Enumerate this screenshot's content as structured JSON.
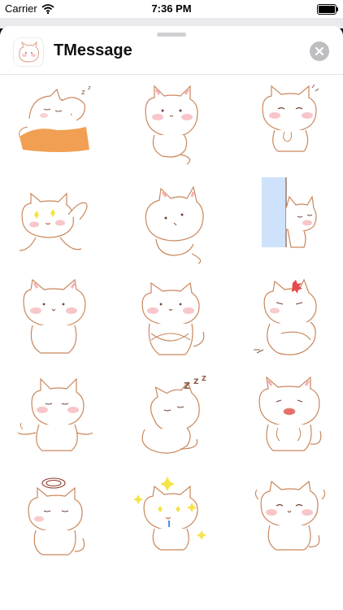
{
  "status_bar": {
    "carrier": "Carrier",
    "time": "7:36 PM"
  },
  "app": {
    "title": "TMessage"
  },
  "stickers": [
    {
      "name": "sleeping"
    },
    {
      "name": "blush-look"
    },
    {
      "name": "hands-together"
    },
    {
      "name": "sparkle-wave"
    },
    {
      "name": "peek-up"
    },
    {
      "name": "door-peek"
    },
    {
      "name": "blank-stare"
    },
    {
      "name": "arms-crossed"
    },
    {
      "name": "angry-crossed"
    },
    {
      "name": "meditate"
    },
    {
      "name": "sleepy-zzz"
    },
    {
      "name": "shocked"
    },
    {
      "name": "dizzy"
    },
    {
      "name": "sparkle-drool"
    },
    {
      "name": "happy"
    }
  ],
  "colors": {
    "line": "#c9875c",
    "blush": "#f6b3b8",
    "accent": "#f09a4a"
  }
}
